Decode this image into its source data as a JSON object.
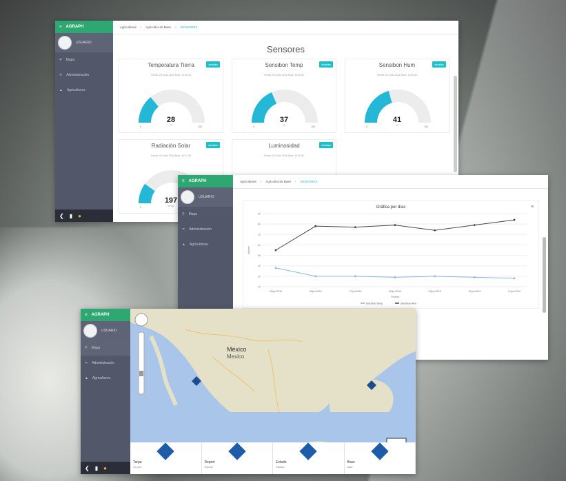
{
  "app": {
    "brand": "AGRAPH",
    "user": "USUARIO",
    "nav": [
      "Mapa",
      "Administración",
      "Agricultores"
    ]
  },
  "win1": {
    "crumbs": [
      "Agricultores",
      "Agricultor de Base",
      "SENSORES"
    ],
    "title": "Sensores",
    "button": "detalles",
    "sensors": [
      {
        "name": "Temperatura Tierra",
        "value": "28",
        "date": "Fecha: 26 Junio 2016 Hora: 12:39:13",
        "min": "0",
        "max": "100",
        "unit": "°C",
        "fraction": 0.28
      },
      {
        "name": "Sensibon Temp",
        "value": "37",
        "date": "Fecha: 26 Junio 2016 Hora: 14:00:30",
        "min": "0",
        "max": "100",
        "unit": "°C",
        "fraction": 0.37
      },
      {
        "name": "Sensibon Hum",
        "value": "41",
        "date": "Fecha: 26 Junio 2016 Hora: 14:00:30",
        "min": "0",
        "max": "100",
        "unit": "%",
        "fraction": 0.41
      },
      {
        "name": "Radiación Solar",
        "value": "197",
        "date": "Fecha: 26 Junio 2016 Hora: 12:31:35",
        "min": "0",
        "max": "",
        "unit": "W/m2",
        "fraction": 0.2
      },
      {
        "name": "Luminosidad",
        "value": "",
        "date": "Fecha: 26 Junio 2016 Hora: 14:00:30",
        "min": "",
        "max": "",
        "unit": "",
        "fraction": 0
      }
    ]
  },
  "win2": {
    "crumbs": [
      "Agricultores",
      "Agricultor de Base",
      "SENSORES"
    ],
    "chart_data": {
      "type": "line",
      "title": "Gráfica por días",
      "xlabel": "Fechas",
      "ylabel": "Valores",
      "x": [
        "05/jun/2016",
        "06/jun/2016",
        "07/jun/2016",
        "08/jun/2016",
        "09/jun/2016",
        "10/jun/2016",
        "11/jun/2016"
      ],
      "ylim": [
        20,
        90
      ],
      "yticks": [
        "20",
        "30",
        "40",
        "50",
        "60",
        "70",
        "80",
        "90"
      ],
      "series": [
        {
          "name": "Sensibon Temp",
          "color": "#8ab6df",
          "values": [
            38,
            30,
            30,
            29,
            30,
            29,
            28
          ]
        },
        {
          "name": "Sensibon Hum",
          "color": "#444444",
          "values": [
            55,
            78,
            77,
            79,
            74,
            79,
            84
          ]
        }
      ],
      "legend": "bottom"
    }
  },
  "win3": {
    "map": {
      "country": "México",
      "country2": "Mexico"
    },
    "tabs": [
      {
        "title": "Tarpa",
        "sub": "Ver pila"
      },
      {
        "title": "Report",
        "sub": "Reporte"
      },
      {
        "title": "Estado",
        "sub": "Estados"
      },
      {
        "title": "Base",
        "sub": "Base"
      }
    ]
  }
}
